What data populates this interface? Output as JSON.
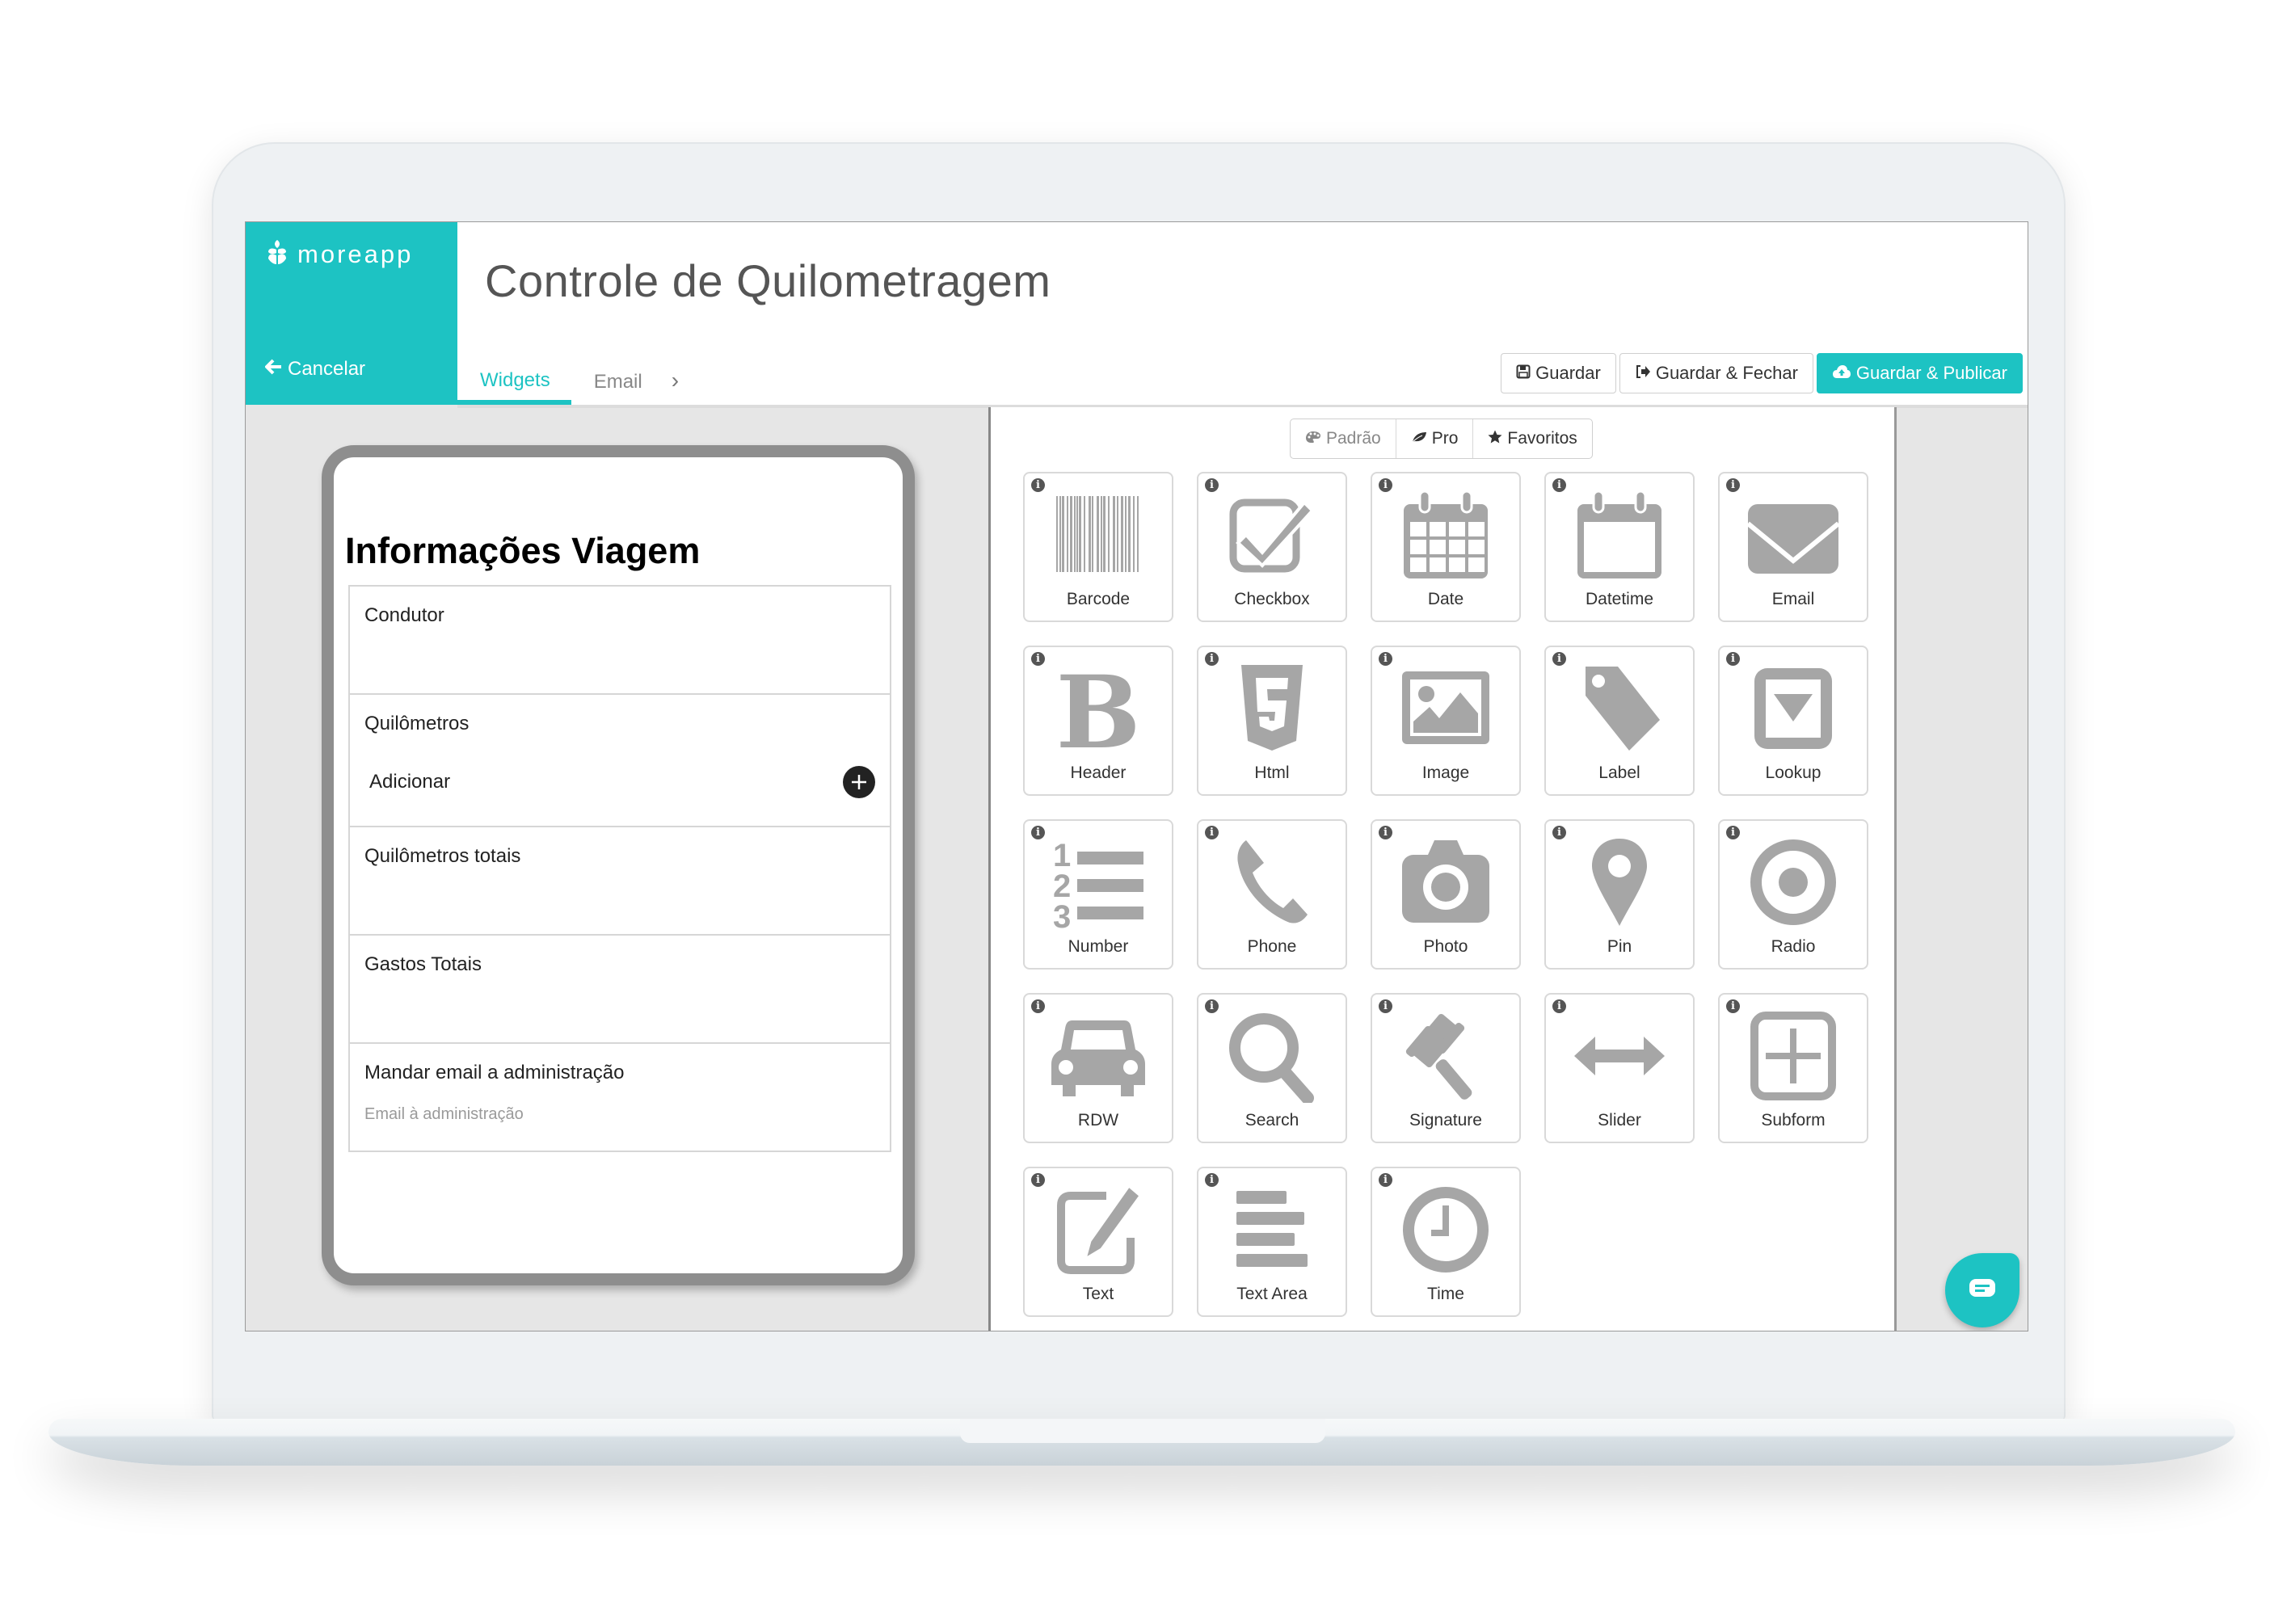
{
  "app": {
    "brand_name": "moreapp",
    "cancel_label": "Cancelar",
    "title": "Controle de Quilometragem",
    "accent_color": "#1dc3c3"
  },
  "tabs": [
    {
      "label": "Widgets",
      "active": true
    },
    {
      "label": "Email",
      "active": false
    },
    {
      "label": "›",
      "active": false
    }
  ],
  "actions": {
    "save": "Guardar",
    "save_close": "Guardar & Fechar",
    "save_publish": "Guardar & Publicar"
  },
  "preview": {
    "form_title": "Informações Viagem",
    "fields": [
      {
        "label": "Condutor"
      },
      {
        "label": "Quilômetros",
        "subform_action": "Adicionar"
      },
      {
        "label": "Quilômetros totais"
      },
      {
        "label": "Gastos Totais"
      },
      {
        "label": "Mandar email a administração",
        "placeholder": "Email à administração"
      }
    ]
  },
  "widget_filters": [
    {
      "label": "Padrão",
      "icon": "palette-icon"
    },
    {
      "label": "Pro",
      "icon": "leaf-icon"
    },
    {
      "label": "Favoritos",
      "icon": "star-icon"
    }
  ],
  "widgets": [
    {
      "label": "Barcode",
      "icon": "barcode-icon"
    },
    {
      "label": "Checkbox",
      "icon": "checkbox-icon"
    },
    {
      "label": "Date",
      "icon": "calendar-icon"
    },
    {
      "label": "Datetime",
      "icon": "calendar-empty-icon"
    },
    {
      "label": "Email",
      "icon": "envelope-icon"
    },
    {
      "label": "Header",
      "icon": "bold-icon"
    },
    {
      "label": "Html",
      "icon": "html5-icon"
    },
    {
      "label": "Image",
      "icon": "image-icon"
    },
    {
      "label": "Label",
      "icon": "tag-icon"
    },
    {
      "label": "Lookup",
      "icon": "dropdown-icon"
    },
    {
      "label": "Number",
      "icon": "ordered-list-icon"
    },
    {
      "label": "Phone",
      "icon": "phone-icon"
    },
    {
      "label": "Photo",
      "icon": "camera-icon"
    },
    {
      "label": "Pin",
      "icon": "map-pin-icon"
    },
    {
      "label": "Radio",
      "icon": "radio-icon"
    },
    {
      "label": "RDW",
      "icon": "car-icon"
    },
    {
      "label": "Search",
      "icon": "search-icon"
    },
    {
      "label": "Signature",
      "icon": "gavel-icon"
    },
    {
      "label": "Slider",
      "icon": "arrows-h-icon"
    },
    {
      "label": "Subform",
      "icon": "plus-square-icon"
    },
    {
      "label": "Text",
      "icon": "edit-icon"
    },
    {
      "label": "Text Area",
      "icon": "align-left-icon"
    },
    {
      "label": "Time",
      "icon": "clock-icon"
    }
  ],
  "info_glyph": "i"
}
